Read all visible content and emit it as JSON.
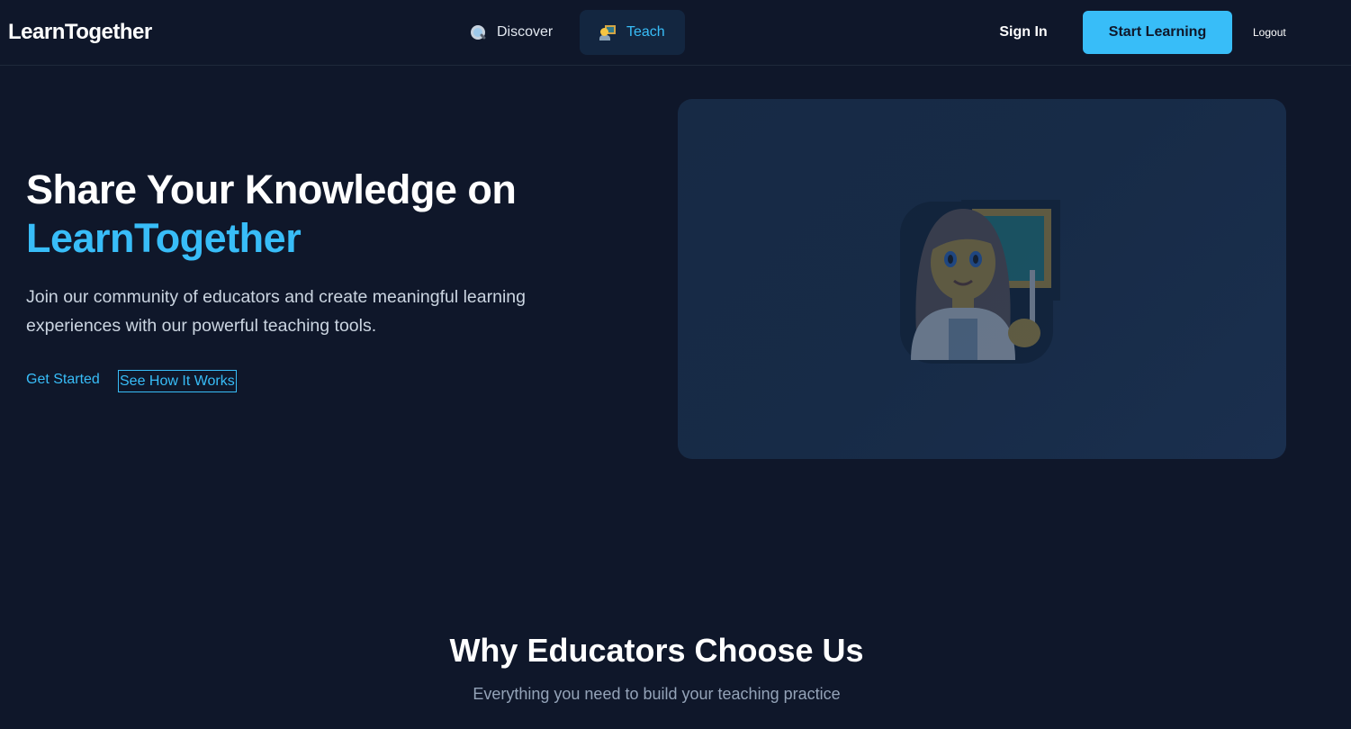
{
  "header": {
    "logo": "LearnTogether",
    "nav": [
      {
        "label": "Discover",
        "icon": "magnifying-glass-icon",
        "active": false
      },
      {
        "label": "Teach",
        "icon": "teacher-icon",
        "active": true
      }
    ],
    "sign_in": "Sign In",
    "start_learning": "Start Learning",
    "logout": "Logout"
  },
  "hero": {
    "title_line1": "Share Your Knowledge on",
    "title_line2": "LearnTogether",
    "description": "Join our community of educators and create meaningful learning experiences with our powerful teaching tools.",
    "get_started": "Get Started",
    "see_how": "See How It Works",
    "illustration_icon": "woman-teacher-icon"
  },
  "why": {
    "title": "Why Educators Choose Us",
    "subtitle": "Everything you need to build your teaching practice"
  },
  "colors": {
    "background": "#0f172a",
    "accent": "#38bdf8",
    "panel": "#172a45",
    "nav_active_bg": "#132640",
    "muted_text": "#94a3b8"
  }
}
